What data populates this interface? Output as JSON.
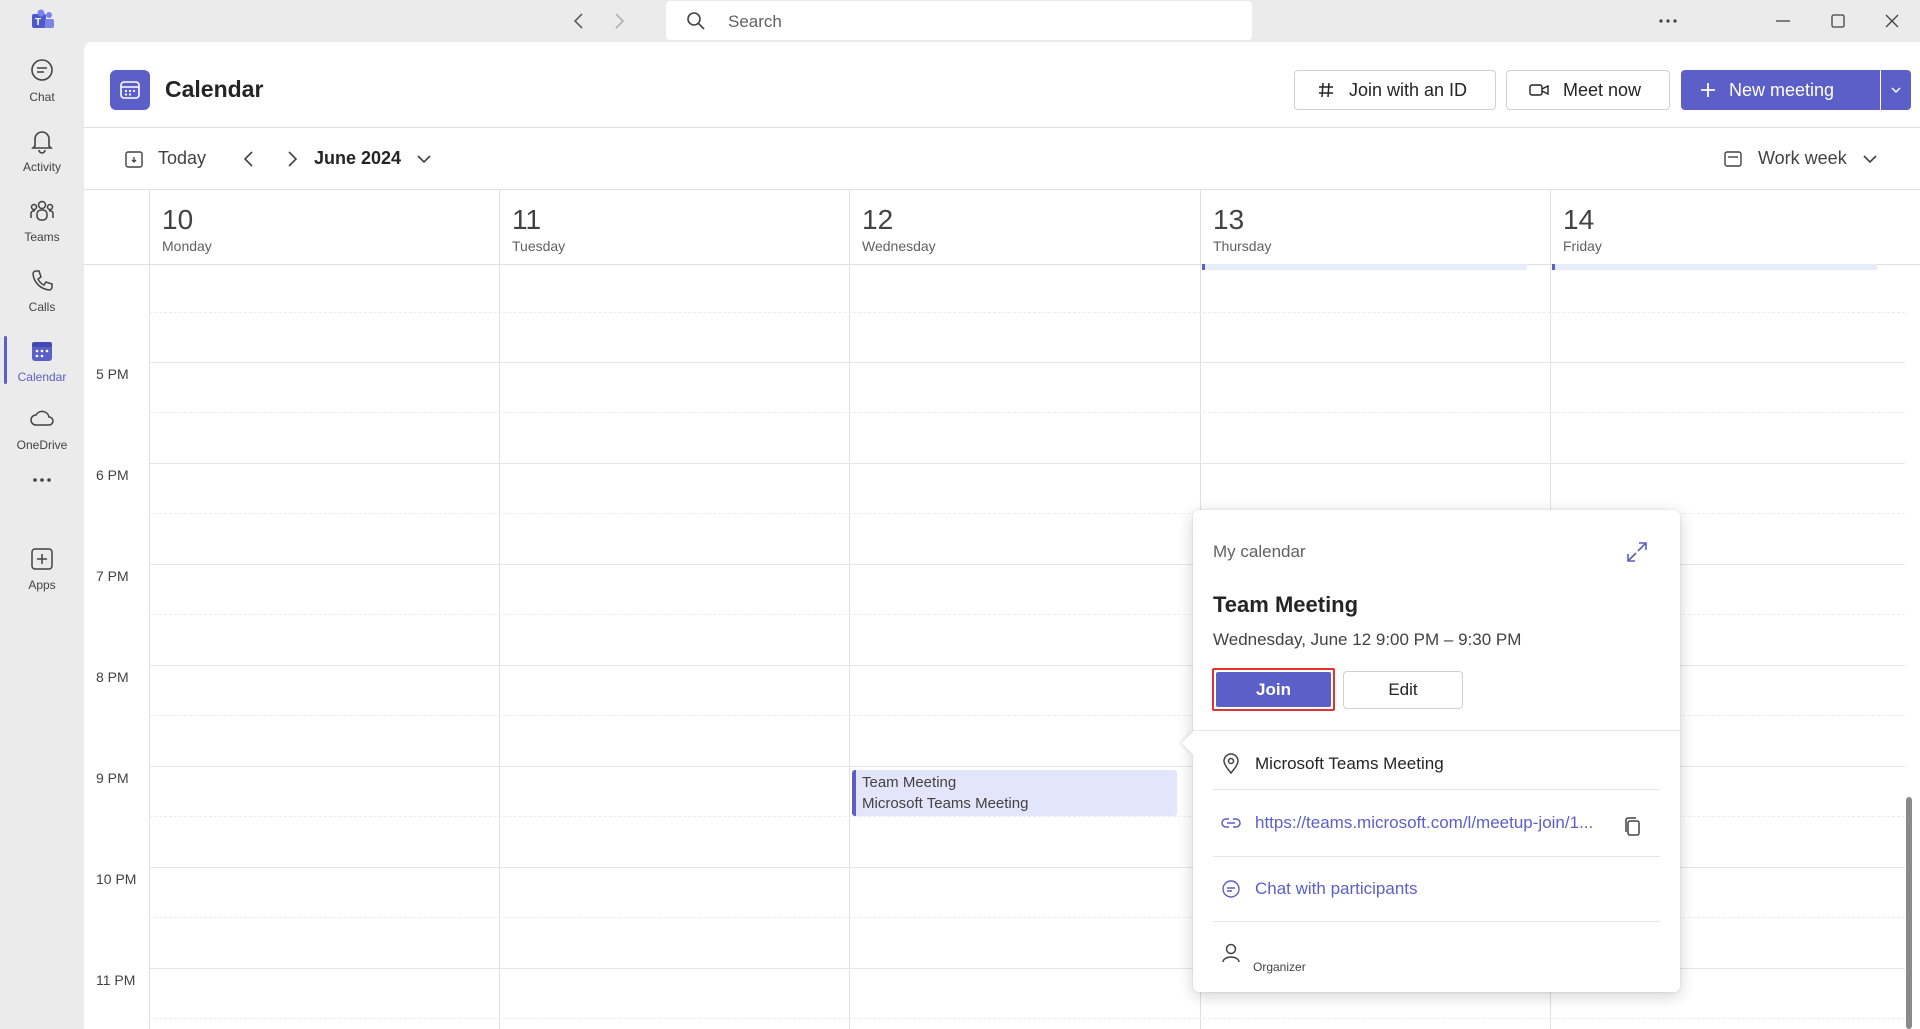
{
  "titlebar": {
    "search_placeholder": "Search"
  },
  "rail": {
    "items": [
      {
        "label": "Chat"
      },
      {
        "label": "Activity"
      },
      {
        "label": "Teams"
      },
      {
        "label": "Calls"
      },
      {
        "label": "Calendar"
      },
      {
        "label": "OneDrive"
      },
      {
        "label": "Apps"
      }
    ]
  },
  "header": {
    "title": "Calendar",
    "join_with_id": "Join with an ID",
    "meet_now": "Meet now",
    "new_meeting": "New meeting"
  },
  "toolbar": {
    "today": "Today",
    "month": "June 2024",
    "view": "Work week"
  },
  "days": [
    {
      "num": "10",
      "name": "Monday"
    },
    {
      "num": "11",
      "name": "Tuesday"
    },
    {
      "num": "12",
      "name": "Wednesday"
    },
    {
      "num": "13",
      "name": "Thursday"
    },
    {
      "num": "14",
      "name": "Friday"
    }
  ],
  "times": [
    "5 PM",
    "6 PM",
    "7 PM",
    "8 PM",
    "9 PM",
    "10 PM",
    "11 PM"
  ],
  "event": {
    "title": "Team Meeting",
    "location": "Microsoft Teams Meeting"
  },
  "popup": {
    "calendar_label": "My calendar",
    "title": "Team Meeting",
    "time": "Wednesday, June 12 9:00 PM – 9:30 PM",
    "join": "Join",
    "edit": "Edit",
    "location": "Microsoft Teams Meeting",
    "link": "https://teams.microsoft.com/l/meetup-join/1...",
    "chat": "Chat with participants",
    "organizer": "Organizer"
  },
  "colors": {
    "accent": "#5b5fc7",
    "highlight": "#e5322d"
  }
}
